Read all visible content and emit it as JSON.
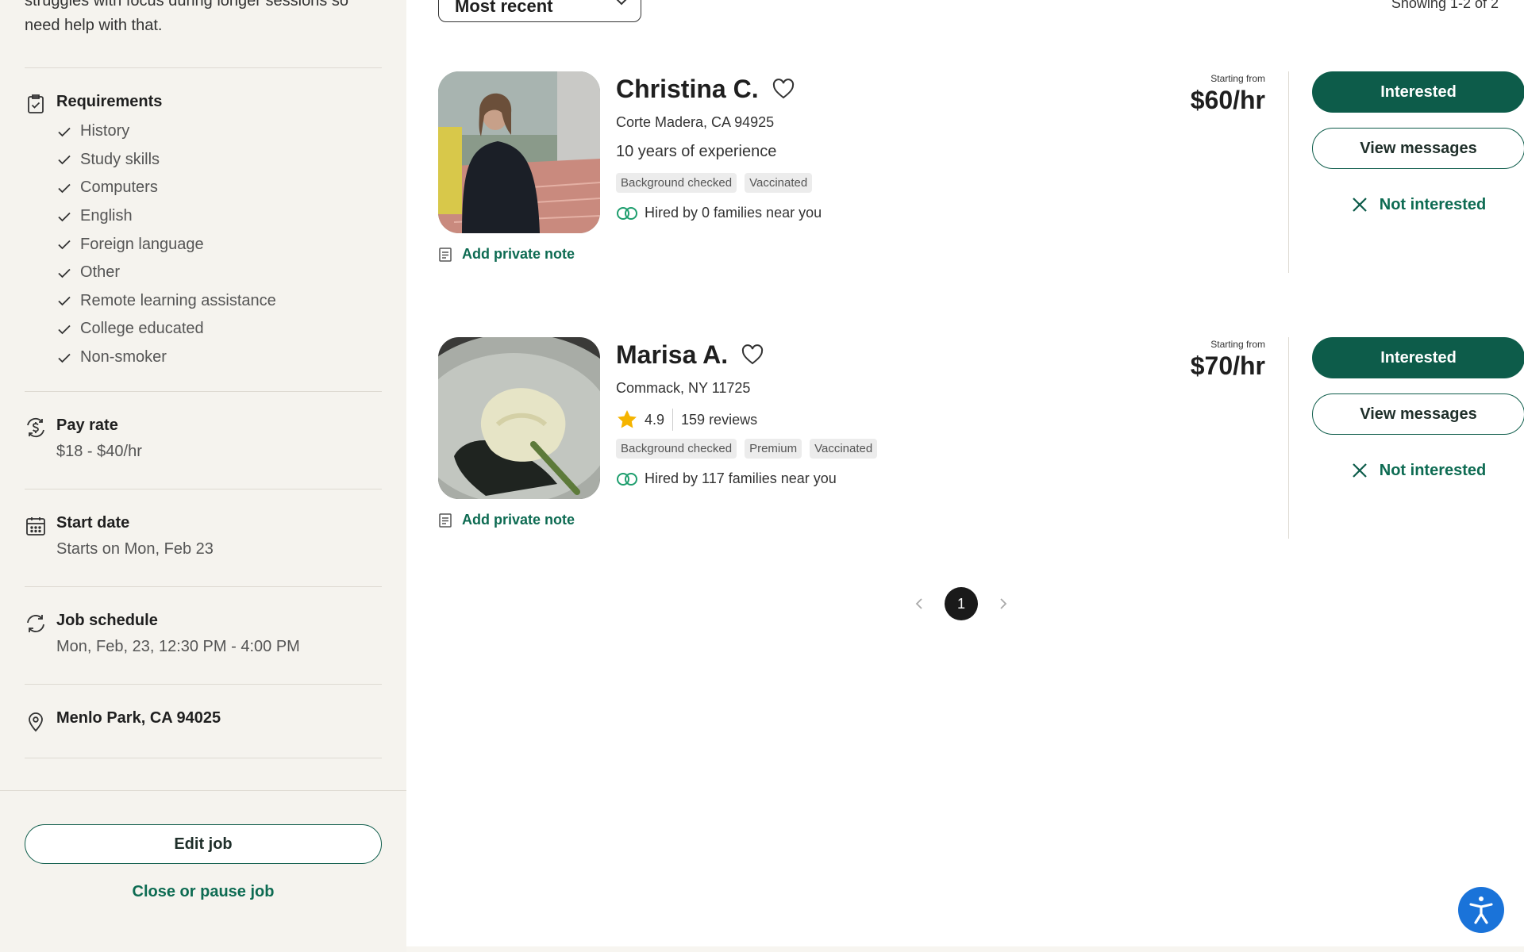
{
  "sidebar": {
    "description": "struggles with focus during longer sessions so need help with that.",
    "requirements": {
      "title": "Requirements",
      "items": [
        "History",
        "Study skills",
        "Computers",
        "English",
        "Foreign language",
        "Other",
        "Remote learning assistance",
        "College educated",
        "Non-smoker"
      ]
    },
    "pay_rate": {
      "title": "Pay rate",
      "value": "$18 - $40/hr"
    },
    "start_date": {
      "title": "Start date",
      "value": "Starts on Mon, Feb 23"
    },
    "job_schedule": {
      "title": "Job schedule",
      "value": "Mon, Feb, 23, 12:30 PM - 4:00 PM"
    },
    "location": {
      "title": "Menlo Park, CA 94025"
    },
    "edit_job_label": "Edit job",
    "close_job_label": "Close or pause job"
  },
  "main": {
    "sort_label": "Most recent",
    "showing_text": "Showing 1-2 of 2",
    "caregivers": [
      {
        "name": "Christina C.",
        "location": "Corte Madera, CA 94925",
        "experience": "10 years of experience",
        "badges": [
          "Background checked",
          "Vaccinated"
        ],
        "hired_text": "Hired by 0 families near you",
        "price_prefix": "Starting from",
        "price": "$60/hr",
        "note_label": "Add private note",
        "interested_label": "Interested",
        "messages_label": "View messages",
        "not_interested_label": "Not interested"
      },
      {
        "name": "Marisa A.",
        "location": "Commack, NY 11725",
        "rating": "4.9",
        "reviews": "159 reviews",
        "badges": [
          "Background checked",
          "Premium",
          "Vaccinated"
        ],
        "hired_text": "Hired by 117 families near you",
        "price_prefix": "Starting from",
        "price": "$70/hr",
        "note_label": "Add private note",
        "interested_label": "Interested",
        "messages_label": "View messages",
        "not_interested_label": "Not interested"
      }
    ],
    "pagination": {
      "current_page": "1"
    }
  },
  "colors": {
    "brand_green": "#0d5c4a",
    "link_green": "#0d6b52",
    "sidebar_bg": "#f5f3ee",
    "accessibility_blue": "#1a73d9",
    "star_yellow": "#f5b400"
  },
  "icons": [
    "clipboard-check-icon",
    "check-icon",
    "money-cycle-icon",
    "calendar-icon",
    "refresh-icon",
    "map-pin-icon",
    "heart-icon",
    "star-icon",
    "hired-rings-icon",
    "note-icon",
    "close-icon",
    "chevron-left-icon",
    "chevron-right-icon",
    "chevron-down-icon",
    "accessibility-icon"
  ]
}
